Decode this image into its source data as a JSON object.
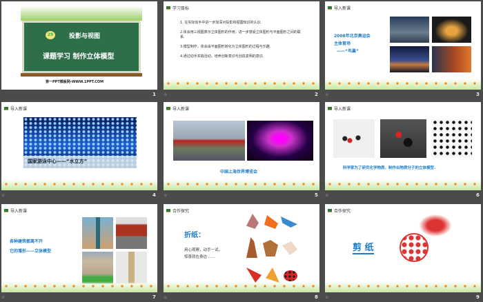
{
  "slides": [
    {
      "number": "1",
      "badge": "29",
      "title": "投影与视图",
      "subtitle": "课题学习 制作立体模型",
      "footer": "第一PPT模板网-WWW.1PPT.COM"
    },
    {
      "number": "2",
      "header": "学习目标",
      "items": [
        "1. 在实际动手中进一步加深对投影和视图知识的认识.",
        "2.体会用三视图表示立体图形的作用，进一步感受立体图形与平面图形之间的联系.",
        "3.模型制作，体会由平面图形转化为立体图形的过程与乐趣.",
        "4.通过动手实践活动，培养创新意识与创造发明的意识."
      ]
    },
    {
      "number": "3",
      "header": "导入新课",
      "lines": [
        "2008年北京奥运会",
        "主体育场",
        "——“鸟巢”"
      ]
    },
    {
      "number": "4",
      "header": "导入新课",
      "caption": "国家游泳中心——“水立方”"
    },
    {
      "number": "5",
      "header": "导入新课",
      "caption": "中国上海世界博览会"
    },
    {
      "number": "6",
      "header": "导入新课",
      "caption": "科学家为了研究化学物质，制作出物质分子的立体模型."
    },
    {
      "number": "7",
      "header": "导入新课",
      "lines": [
        "各种建筑都离不开",
        "它的雏形——立体模型"
      ]
    },
    {
      "number": "8",
      "header": "合作探究",
      "title": "折纸：",
      "lines": [
        "用心观察，动手一试，",
        "惊喜就在身边 ……"
      ]
    },
    {
      "number": "9",
      "header": "合作探究",
      "title": "剪 纸"
    }
  ],
  "star_icon": "☆"
}
